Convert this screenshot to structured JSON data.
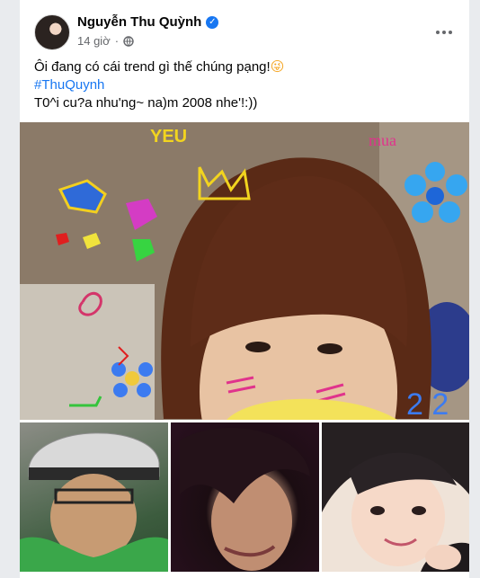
{
  "post": {
    "author": "Nguyễn Thu Quỳnh",
    "timestamp": "14 giờ",
    "verified_icon": "check-badge-icon",
    "privacy_icon": "globe-icon",
    "more_icon": "more-dots-icon",
    "text_line1": "Ôi đang có cái trend gì thế chúng pạng!",
    "emoji": "😜",
    "hashtag": "#ThuQuynh",
    "text_line3": "T0^i cu?a nhu'ng~ na)m 2008 nhe'!:))"
  },
  "photos": {
    "main": "main-photo-selfie-with-doodles",
    "thumbnails": [
      "thumbnail-helmet-photo",
      "thumbnail-fringe-photo",
      "thumbnail-smiling-photo"
    ]
  },
  "doodle_text": {
    "top_left": "YEU",
    "top_right": "mua",
    "bottom_right": "2 2"
  },
  "colors": {
    "link": "#1877f2",
    "secondary_text": "#65676b",
    "background": "#e9ebee"
  }
}
